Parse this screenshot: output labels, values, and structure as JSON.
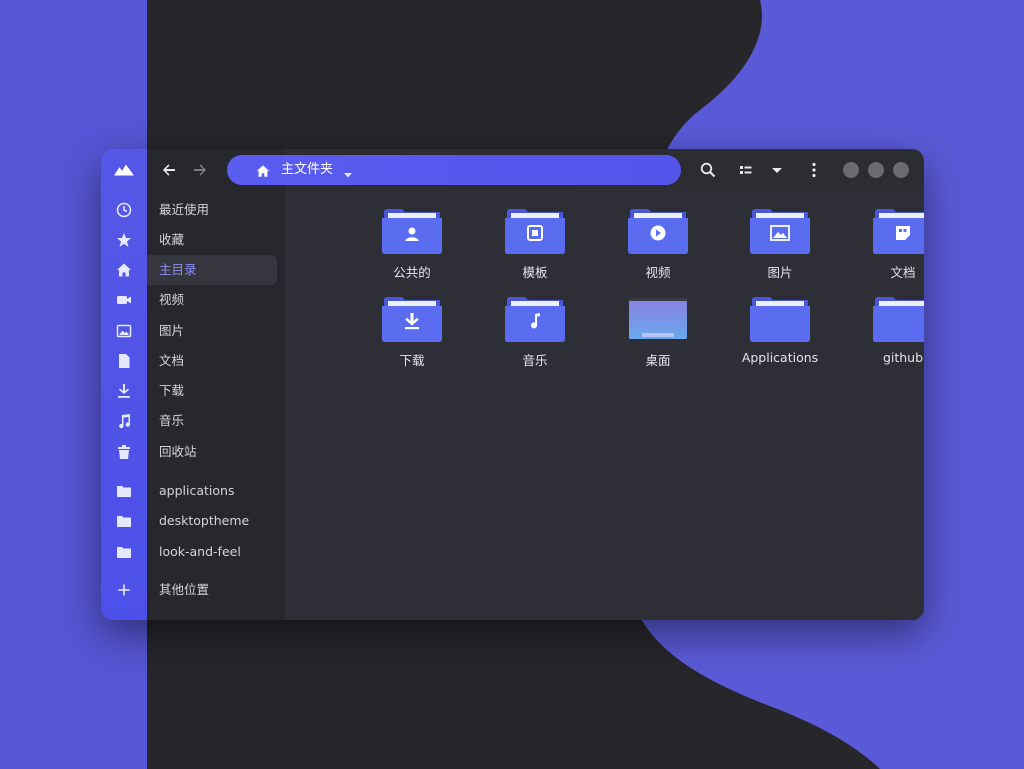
{
  "colors": {
    "accent": "#5557e6",
    "folder": "#5a6cf0",
    "background_dark": "#2a2a30",
    "background_purple": "#5a5ad8",
    "active_text": "#8e8ff6"
  },
  "header": {
    "path_label": "主文件夹",
    "icons": [
      "back-arrow-icon",
      "forward-arrow-icon",
      "home-icon",
      "chevron-down-icon",
      "search-icon",
      "list-view-icon",
      "chevron-down-icon",
      "kebab-menu-icon"
    ]
  },
  "sidebar": {
    "items": [
      {
        "label": "最近使用",
        "icon": "clock-icon"
      },
      {
        "label": "收藏",
        "icon": "star-icon"
      },
      {
        "label": "主目录",
        "icon": "home-icon",
        "active": true
      },
      {
        "label": "视频",
        "icon": "video-icon"
      },
      {
        "label": "图片",
        "icon": "image-icon"
      },
      {
        "label": "文档",
        "icon": "document-icon"
      },
      {
        "label": "下载",
        "icon": "download-icon"
      },
      {
        "label": "音乐",
        "icon": "music-icon"
      },
      {
        "label": "回收站",
        "icon": "trash-icon"
      }
    ],
    "bookmarks": [
      {
        "label": "applications",
        "icon": "folder-icon"
      },
      {
        "label": "desktoptheme",
        "icon": "folder-icon"
      },
      {
        "label": "look-and-feel",
        "icon": "folder-icon"
      }
    ],
    "other_locations": {
      "label": "其他位置",
      "icon": "plus-icon"
    }
  },
  "files": [
    {
      "name": "公共的",
      "icon": "user-folder-icon"
    },
    {
      "name": "模板",
      "icon": "template-folder-icon"
    },
    {
      "name": "视频",
      "icon": "video-folder-icon"
    },
    {
      "name": "图片",
      "icon": "image-folder-icon"
    },
    {
      "name": "文档",
      "icon": "document-folder-icon"
    },
    {
      "name": "下载",
      "icon": "download-folder-icon"
    },
    {
      "name": "音乐",
      "icon": "music-folder-icon"
    },
    {
      "name": "桌面",
      "icon": "desktop-folder-icon"
    },
    {
      "name": "Applications",
      "icon": "folder-icon"
    },
    {
      "name": "github",
      "icon": "folder-icon"
    }
  ]
}
